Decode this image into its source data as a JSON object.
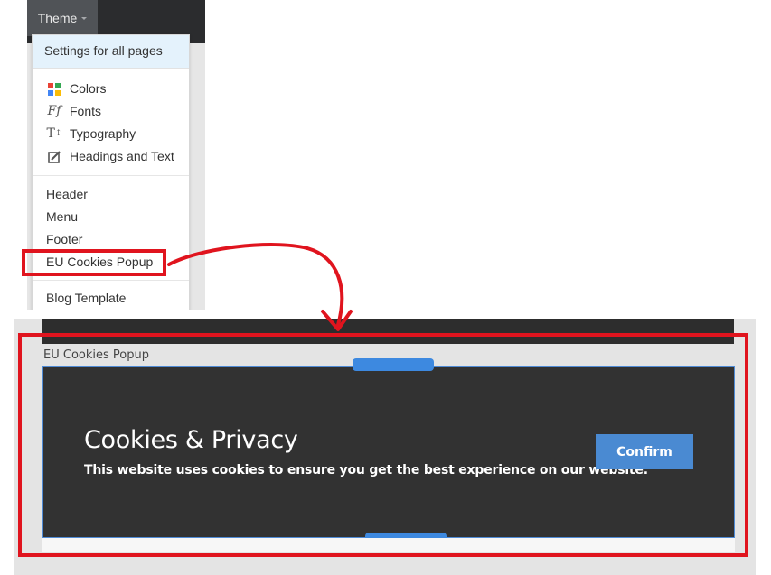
{
  "theme_menu": {
    "tab_label": "Theme",
    "header": "Settings for all pages",
    "group1": [
      {
        "label": "Colors",
        "icon": "colors-icon"
      },
      {
        "label": "Fonts",
        "icon": "fonts-icon"
      },
      {
        "label": "Typography",
        "icon": "typography-icon"
      },
      {
        "label": "Headings and Text",
        "icon": "headings-icon"
      }
    ],
    "group2": [
      "Header",
      "Menu",
      "Footer",
      "EU Cookies Popup"
    ],
    "group3": [
      "Blog Template"
    ]
  },
  "preview": {
    "section_label": "EU Cookies Popup",
    "title": "Cookies & Privacy",
    "text": "This website uses cookies to ensure you get the best experience on our website.",
    "confirm_label": "Confirm"
  },
  "colors": {
    "highlight_red": "#e0141e",
    "popup_bg": "#323232",
    "button_blue": "#4a8ad2",
    "handle_blue": "#3d89e0"
  }
}
